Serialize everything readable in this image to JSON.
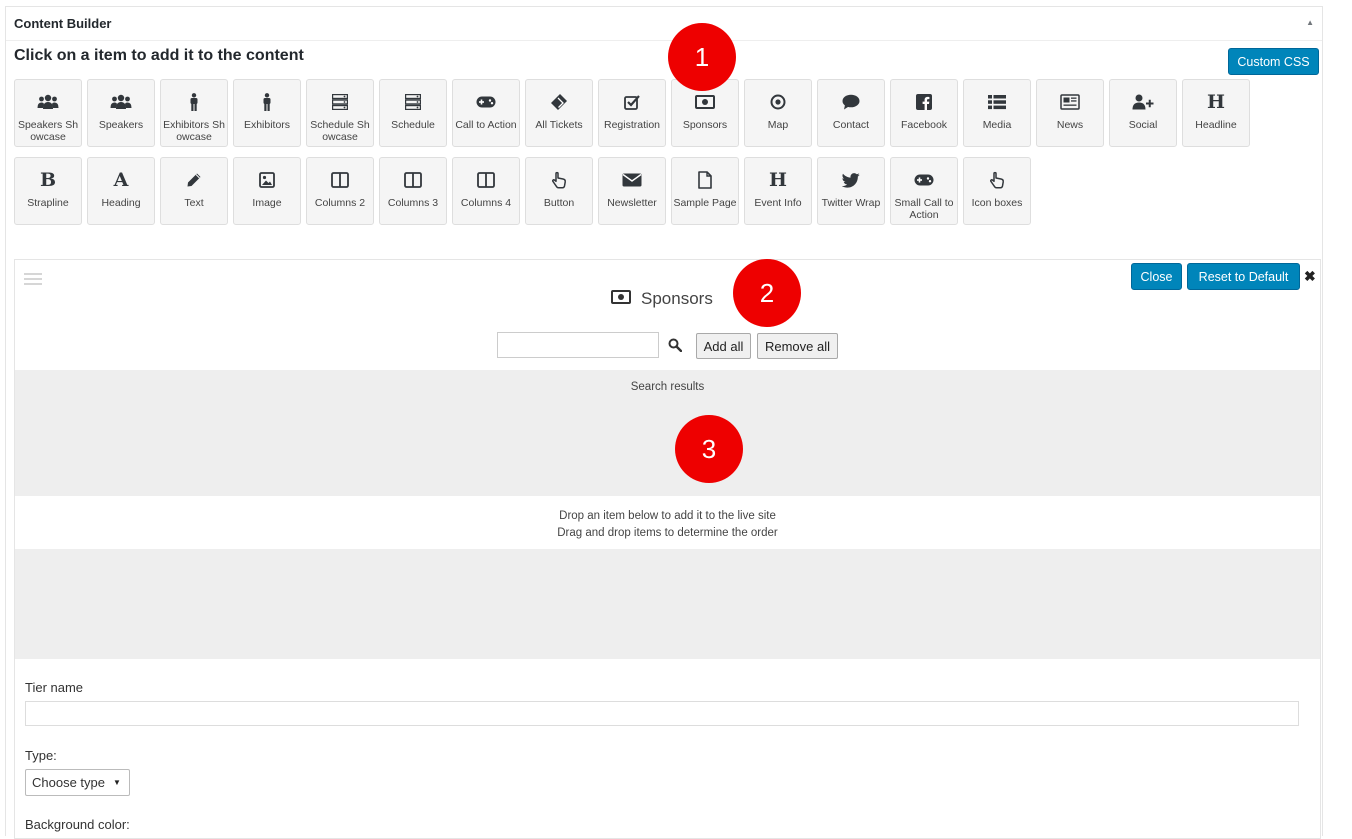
{
  "panel": {
    "title": "Content Builder",
    "toggle_icon": "▲",
    "instructions": "Click on a item to add it to the content",
    "custom_css_label": "Custom CSS"
  },
  "tiles": [
    {
      "label": "Speakers Showcase",
      "icon": "users-icon"
    },
    {
      "label": "Speakers",
      "icon": "users-icon"
    },
    {
      "label": "Exhibitors Showcase",
      "icon": "male-icon"
    },
    {
      "label": "Exhibitors",
      "icon": "male-icon"
    },
    {
      "label": "Schedule Showcase",
      "icon": "server-icon"
    },
    {
      "label": "Schedule",
      "icon": "server-icon"
    },
    {
      "label": "Call to Action",
      "icon": "gamepad-icon"
    },
    {
      "label": "All Tickets",
      "icon": "ticket-icon"
    },
    {
      "label": "Registration",
      "icon": "check-square-icon"
    },
    {
      "label": "Sponsors",
      "icon": "money-icon"
    },
    {
      "label": "Map",
      "icon": "dot-circle-icon"
    },
    {
      "label": "Contact",
      "icon": "comment-icon"
    },
    {
      "label": "Facebook",
      "icon": "facebook-icon"
    },
    {
      "label": "Media",
      "icon": "list-icon"
    },
    {
      "label": "News",
      "icon": "newspaper-icon"
    },
    {
      "label": "Social",
      "icon": "user-plus-icon"
    },
    {
      "label": "Headline",
      "icon": "header-icon",
      "glyph": "H"
    },
    {
      "label": "Strapline",
      "icon": "bold-icon",
      "glyph": "B"
    },
    {
      "label": "Heading",
      "icon": "font-icon",
      "glyph": "A"
    },
    {
      "label": "Text",
      "icon": "pencil-icon"
    },
    {
      "label": "Image",
      "icon": "image-icon"
    },
    {
      "label": "Columns 2",
      "icon": "columns-icon"
    },
    {
      "label": "Columns 3",
      "icon": "columns-icon"
    },
    {
      "label": "Columns 4",
      "icon": "columns-icon"
    },
    {
      "label": "Button",
      "icon": "hand-pointer-icon"
    },
    {
      "label": "Newsletter",
      "icon": "envelope-icon"
    },
    {
      "label": "Sample Page",
      "icon": "file-icon"
    },
    {
      "label": "Event Info",
      "icon": "header-icon",
      "glyph": "H"
    },
    {
      "label": "Twitter Wrap",
      "icon": "twitter-icon"
    },
    {
      "label": "Small Call to Action",
      "icon": "gamepad-icon"
    },
    {
      "label": "Icon boxes",
      "icon": "hand-pointer-icon"
    }
  ],
  "section": {
    "title": "Sponsors",
    "title_icon": "money-icon",
    "close_label": "Close",
    "reset_label": "Reset to Default",
    "remove_icon": "✖",
    "search_value": "",
    "add_all_label": "Add all",
    "remove_all_label": "Remove all",
    "search_results_label": "Search results",
    "drop_line_1": "Drop an item below to add it to the live site",
    "drop_line_2": "Drag and drop items to determine the order",
    "tier_name_label": "Tier name",
    "tier_name_value": "",
    "type_label": "Type:",
    "type_selected": "Choose type",
    "background_color_label": "Background color:"
  },
  "callouts": [
    "1",
    "2",
    "3"
  ],
  "colors": {
    "primary_button": "#0085ba",
    "callout_badge": "#ee0000",
    "area_gray": "#eeeeee"
  }
}
